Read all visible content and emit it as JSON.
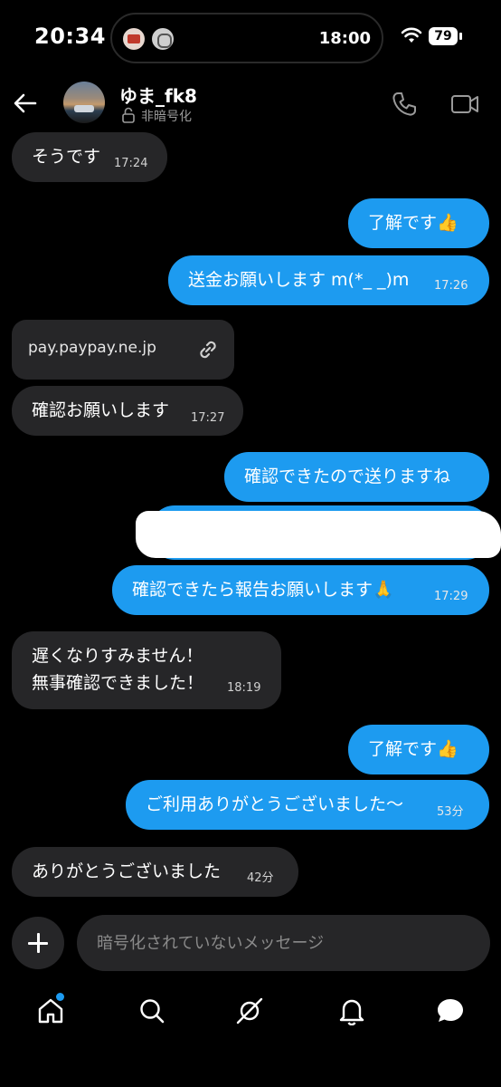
{
  "status_bar": {
    "time": "20:34",
    "island_time": "18:00",
    "battery": "79"
  },
  "header": {
    "username": "ゆま_fk8",
    "encryption_label": "非暗号化",
    "icons": [
      "back-arrow-icon",
      "phone-icon",
      "video-call-icon"
    ]
  },
  "messages": [
    {
      "side": "in",
      "text": "そうです",
      "time": "17:24"
    },
    {
      "side": "out",
      "text": "了解です👍",
      "time": ""
    },
    {
      "side": "out",
      "text": "送金お願いします m(*_ _)m",
      "time": "17:26"
    },
    {
      "side": "in",
      "type": "link",
      "text": "pay.paypay.ne.jp"
    },
    {
      "side": "in",
      "text": "確認お願いします",
      "time": "17:27"
    },
    {
      "side": "out",
      "text": "確認できたので送りますね",
      "time": ""
    },
    {
      "side": "out",
      "type": "redacted",
      "text": ""
    },
    {
      "side": "out",
      "text": "確認できたら報告お願いします🙏",
      "time": "17:29"
    },
    {
      "side": "in",
      "lines": [
        "遅くなりすみません！",
        "無事確認できました！"
      ],
      "time": "18:19"
    },
    {
      "side": "out",
      "text": "了解です👍",
      "time": ""
    },
    {
      "side": "out",
      "text": "ご利用ありがとうございました〜",
      "time": "53分"
    },
    {
      "side": "in",
      "text": "ありがとうございました",
      "time": "42分"
    }
  ],
  "composer": {
    "placeholder": "暗号化されていないメッセージ"
  },
  "nav": {
    "items": [
      "home-icon",
      "search-icon",
      "grok-icon",
      "notifications-icon",
      "messages-icon"
    ]
  },
  "colors": {
    "outgoing_bubble": "#1d9bf0",
    "incoming_bubble": "#262628",
    "background": "#000000"
  }
}
